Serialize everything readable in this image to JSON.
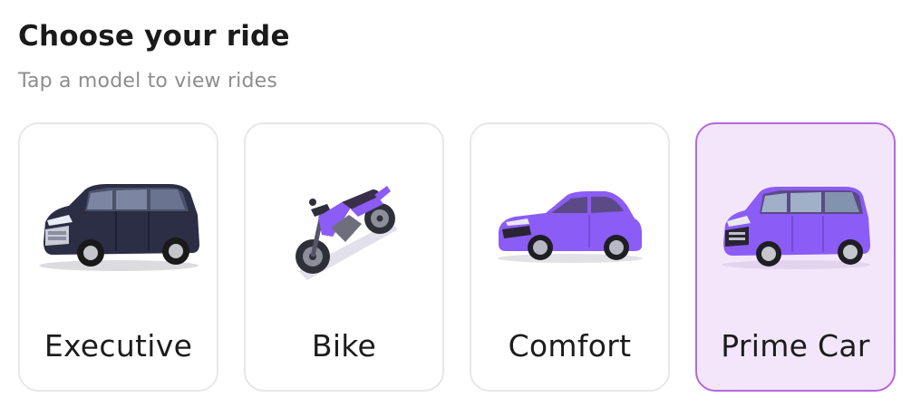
{
  "header": {
    "title": "Choose your ride",
    "subtitle": "Tap a model to view rides"
  },
  "rides": [
    {
      "label": "Executive",
      "icon": "executive-van-icon",
      "selected": false
    },
    {
      "label": "Bike",
      "icon": "motorbike-icon",
      "selected": false
    },
    {
      "label": "Comfort",
      "icon": "sedan-icon",
      "selected": false
    },
    {
      "label": "Prime Car",
      "icon": "minivan-icon",
      "selected": true
    }
  ],
  "colors": {
    "accent_purple": "#8b5cf6",
    "selected_bg": "#f3e6fb",
    "selected_border": "#b468dc",
    "executive_body": "#2b2e45",
    "card_border": "#e7e7e7",
    "subtitle_gray": "#8d8d8d"
  }
}
